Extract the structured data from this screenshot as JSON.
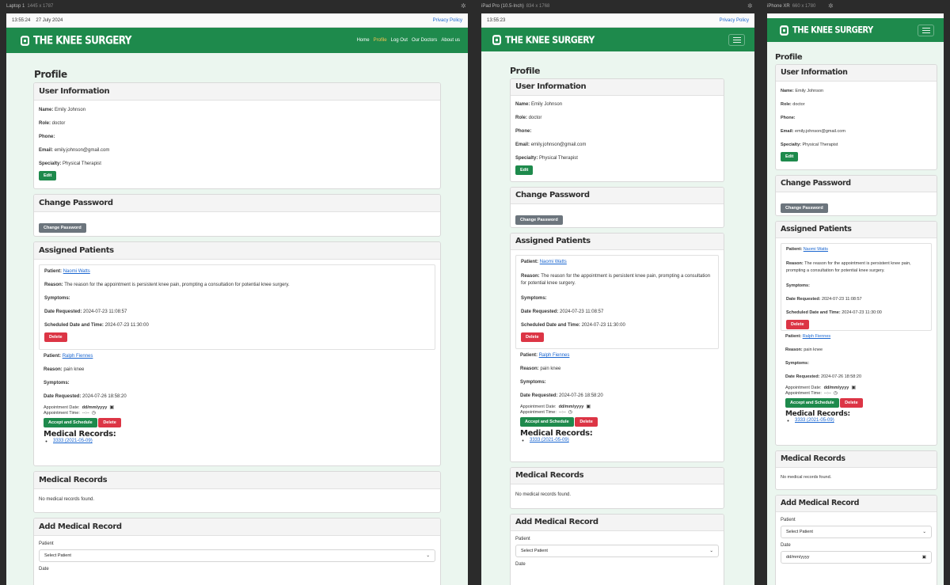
{
  "devices": [
    {
      "label": "Laptop 1",
      "dims": "1445 x 1787"
    },
    {
      "label": "iPad Pro (10.5-Inch)",
      "dims": "834 x 1768"
    },
    {
      "label": "iPhone XR",
      "dims": "660 x 1780"
    }
  ],
  "status": {
    "laptop_time": "13:55:24",
    "laptop_date": "27 July 2024",
    "ipad_time": "13:55:23",
    "privacy": "Privacy Policy"
  },
  "brand": "THE KNEE SURGERY",
  "nav": [
    "Home",
    "Profile",
    "Log Out",
    "Our Doctors",
    "About us"
  ],
  "page_title": "Profile",
  "user_info": {
    "heading": "User Information",
    "name_label": "Name:",
    "name": "Emily Johnson",
    "role_label": "Role:",
    "role": "doctor",
    "phone_label": "Phone:",
    "phone": "",
    "email_label": "Email:",
    "email": "emily.johnson@gmail.com",
    "specialty_label": "Specialty:",
    "specialty": "Physical Therapist",
    "edit_btn": "Edit"
  },
  "change_password": {
    "heading": "Change Password",
    "btn": "Change Password"
  },
  "assigned": {
    "heading": "Assigned Patients",
    "patient_label": "Patient:",
    "reason_label": "Reason:",
    "symptoms_label": "Symptoms:",
    "date_req_label": "Date Requested:",
    "sched_label": "Scheduled Date and Time:",
    "appt_date_label": "Appointment Date:",
    "appt_time_label": "Appointment Time:",
    "date_placeholder": "dd/mm/yyyy",
    "time_placeholder": "--:--",
    "delete_btn": "Delete",
    "accept_btn": "Accept and Schedule",
    "p1": {
      "name": "Naomi Watts",
      "reason": "The reason for the appointment is persistent knee pain, prompting a consultation for potential knee surgery.",
      "date_requested": "2024-07-23 11:08:57",
      "scheduled": "2024-07-23 11:30:00"
    },
    "p2": {
      "name": "Ralph Fiennes",
      "reason": "pain knee",
      "date_requested": "2024-07-26 18:58:20"
    },
    "mr_heading": "Medical Records:",
    "mr_item": "3333 (2021-05-09)"
  },
  "medical_records": {
    "heading": "Medical Records",
    "empty": "No medical records found."
  },
  "add_record": {
    "heading": "Add Medical Record",
    "patient_label": "Patient",
    "select_placeholder": "Select Patient",
    "date_label": "Date",
    "date_placeholder": "dd/mm/yyyy"
  }
}
